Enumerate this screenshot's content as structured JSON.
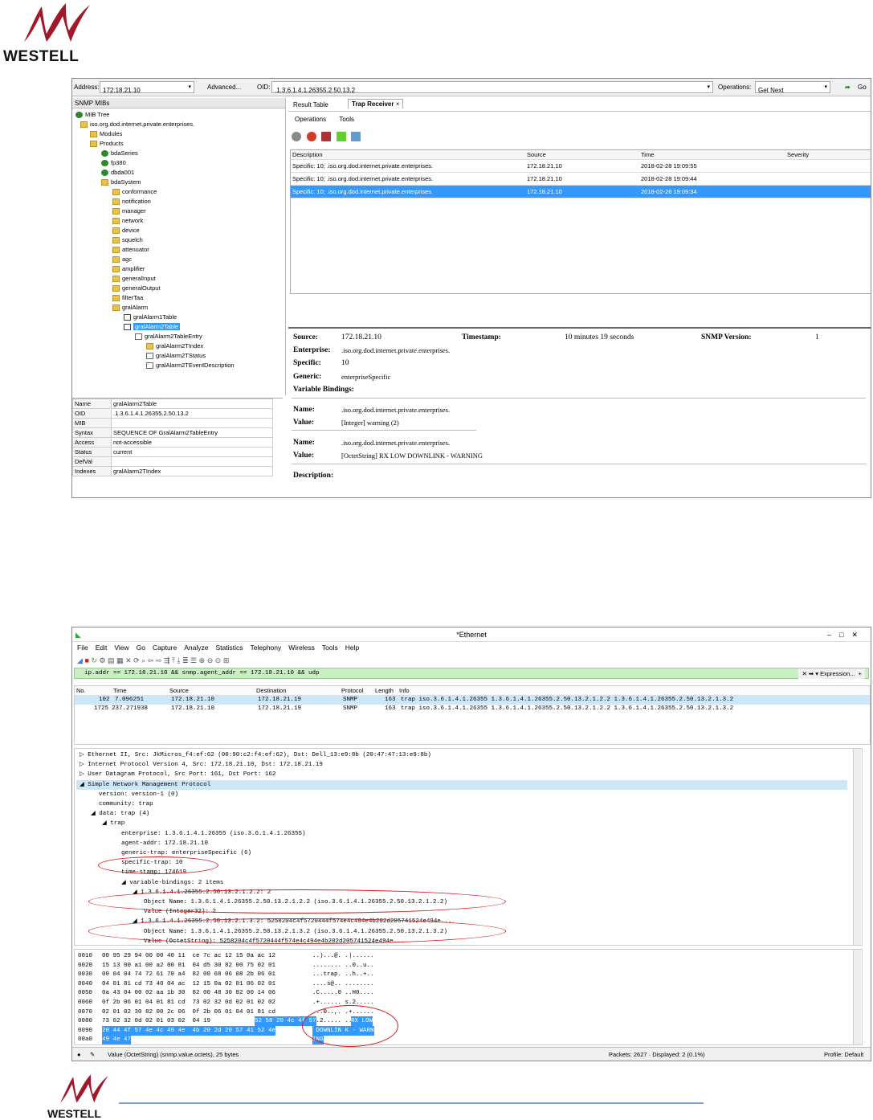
{
  "header_logo": {
    "word": "WESTELL"
  },
  "footer_logo": {
    "word": "WESTELL"
  },
  "mib": {
    "address_label": "Address:",
    "address_value": "172.18.21.10",
    "advanced": "Advanced...",
    "oid_label": "OID:",
    "oid_value": ".1.3.6.1.4.1.26355.2.50.13.2",
    "operations_label": "Operations:",
    "operations_value": "Get Next",
    "go": "Go",
    "left_title": "SNMP MIBs",
    "tree": [
      {
        "label": "MIB Tree",
        "icon": "tree-icon"
      },
      {
        "label": "iso.org.dod.internet.private.enterprises.",
        "icon": "folder-icon"
      },
      {
        "label": "Modules",
        "icon": "folder-icon"
      },
      {
        "label": "Products",
        "icon": "folder-icon"
      },
      {
        "label": "bdaSeries",
        "icon": "leaf-icon"
      },
      {
        "label": "fp380",
        "icon": "leaf-icon"
      },
      {
        "label": "dbda001",
        "icon": "leaf-icon"
      },
      {
        "label": "bdaSystem",
        "icon": "folder-icon"
      },
      {
        "label": "conformance",
        "icon": "folder-icon"
      },
      {
        "label": "notification",
        "icon": "folder-icon"
      },
      {
        "label": "manager",
        "icon": "folder-icon"
      },
      {
        "label": "network",
        "icon": "folder-icon"
      },
      {
        "label": "device",
        "icon": "folder-icon"
      },
      {
        "label": "squelch",
        "icon": "folder-icon"
      },
      {
        "label": "attenuator",
        "icon": "folder-icon"
      },
      {
        "label": "agc",
        "icon": "folder-icon"
      },
      {
        "label": "amplifier",
        "icon": "folder-icon"
      },
      {
        "label": "generalInput",
        "icon": "folder-icon"
      },
      {
        "label": "generalOutput",
        "icon": "folder-icon"
      },
      {
        "label": "filterTaa",
        "icon": "folder-icon"
      },
      {
        "label": "gralAlarm",
        "icon": "folder-icon"
      },
      {
        "label": "gralAlarm1Table",
        "icon": "table-icon"
      },
      {
        "label": "gralAlarm2Table",
        "icon": "table-icon"
      },
      {
        "label": "gralAlarm2TableEntry",
        "icon": "entry-icon"
      },
      {
        "label": "gralAlarm2TIndex",
        "icon": "key-icon"
      },
      {
        "label": "gralAlarm2TStatus",
        "icon": "column-icon"
      },
      {
        "label": "gralAlarm2TEventDescription",
        "icon": "column-icon"
      }
    ],
    "props": [
      [
        "Name",
        "gralAlarm2Table"
      ],
      [
        "OID",
        ".1.3.6.1.4.1.26355.2.50.13.2"
      ],
      [
        "MIB",
        ""
      ],
      [
        "Syntax",
        "SEQUENCE OF GralAlarm2TableEntry"
      ],
      [
        "Access",
        "not-accessible"
      ],
      [
        "Status",
        "current"
      ],
      [
        "DefVal",
        ""
      ],
      [
        "Indexes",
        "gralAlarm2TIndex"
      ]
    ],
    "tab_result": "Result Table",
    "tab_trap": "Trap Receiver",
    "menu_operations": "Operations",
    "menu_tools": "Tools",
    "cols": [
      "Description",
      "Source",
      "Time",
      "Severity"
    ],
    "rows": [
      [
        "Specific: 10; .iso.org.dod.internet.private.enterprises.",
        "172.18.21.10",
        "2018-02-28 19:09:55",
        ""
      ],
      [
        "Specific: 10; .iso.org.dod.internet.private.enterprises.",
        "172.18.21.10",
        "2018-02-28 19:09:44",
        ""
      ],
      [
        "Specific: 10; .iso.org.dod.internet.private.enterprises.",
        "172.18.21.10",
        "2018-02-28 19:09:34",
        ""
      ]
    ],
    "detail": {
      "source_label": "Source:",
      "source": "172.18.21.10",
      "timestamp_label": "Timestamp:",
      "timestamp": "10 minutes 19 seconds",
      "version_label": "SNMP Version:",
      "version": "1",
      "enterprise_label": "Enterprise:",
      "enterprise": ".iso.org.dod.internet.private.enterprises.",
      "specific_label": "Specific:",
      "specific": "10",
      "generic_label": "Generic:",
      "generic": "enterpriseSpecific",
      "vb_label": "Variable Bindings:",
      "name_label": "Name:",
      "value_label": "Value:",
      "name1": ".iso.org.dod.internet.private.enterprises.",
      "value1": "[Integer] warning (2)",
      "name2": ".iso.org.dod.internet.private.enterprises.",
      "value2": "[OctetString] RX LOW DOWNLINK - WARNING",
      "desc_label": "Description:"
    }
  },
  "ws": {
    "title": "*Ethernet",
    "menu": [
      "File",
      "Edit",
      "View",
      "Go",
      "Capture",
      "Analyze",
      "Statistics",
      "Telephony",
      "Wireless",
      "Tools",
      "Help"
    ],
    "filter": "ip.addr == 172.18.21.10 && snmp.agent_addr == 172.18.21.10 && udp",
    "expression": "Expression...",
    "cols": [
      "No.",
      "Time",
      "Source",
      "Destination",
      "Protocol",
      "Length",
      "Info"
    ],
    "packets": [
      [
        "102",
        "7.096251",
        "172.18.21.10",
        "172.18.21.19",
        "SNMP",
        "163",
        "trap iso.3.6.1.4.1.26355 1.3.6.1.4.1.26355.2.50.13.2.1.2.2 1.3.6.1.4.1.26355.2.50.13.2.1.3.2"
      ],
      [
        "1725",
        "237.271938",
        "172.18.21.10",
        "172.18.21.19",
        "SNMP",
        "163",
        "trap iso.3.6.1.4.1.26355 1.3.6.1.4.1.26355.2.50.13.2.1.2.2 1.3.6.1.4.1.26355.2.50.13.2.1.3.2"
      ]
    ],
    "details": [
      "Ethernet II, Src: JkMicros_f4:ef:62 (00:90:c2:f4:ef:62), Dst: Dell_13:e9:8b (20:47:47:13:e9:8b)",
      "Internet Protocol Version 4, Src: 172.18.21.10, Dst: 172.18.21.19",
      "User Datagram Protocol, Src Port: 161, Dst Port: 162",
      "Simple Network Management Protocol",
      "version: version-1 (0)",
      "community: trap",
      "data: trap (4)",
      "trap",
      "enterprise: 1.3.6.1.4.1.26355 (iso.3.6.1.4.1.26355)",
      "agent-addr: 172.18.21.10",
      "generic-trap: enterpriseSpecific (6)",
      "specific-trap: 10",
      "time-stamp: 174619",
      "variable-bindings: 2 items",
      "1.3.6.1.4.1.26355.2.50.13.2.1.2.2: 2",
      "Object Name: 1.3.6.1.4.1.26355.2.50.13.2.1.2.2 (iso.3.6.1.4.1.26355.2.50.13.2.1.2.2)",
      "Value (Integer32): 2",
      "1.3.6.1.4.1.26355.2.50.13.2.1.3.2: 5258204c4f5720444f574e4c494e4b202d205741524e494e...",
      "Object Name: 1.3.6.1.4.1.26355.2.50.13.2.1.3.2 (iso.3.6.1.4.1.26355.2.50.13.2.1.3.2)",
      "Value (OctetString): 5258204c4f5720444f574e4c494e4b202d205741524e494e..."
    ],
    "hex": [
      [
        "0010",
        "00 95 29 94 00 00 40 11  ce 7c ac 12 15 0a ac 12",
        "..)...@. .|......",
        ""
      ],
      [
        "0020",
        "15 13 00 a1 00 a2 00 81  04 d5 30 82 00 75 02 01",
        "........ ..0..u..",
        ""
      ],
      [
        "0030",
        "00 04 04 74 72 61 70 a4  82 00 68 06 08 2b 06 01",
        "...trap. ..h..+..",
        ""
      ],
      [
        "0040",
        "04 01 81 cd 73 40 04 ac  12 15 0a 02 01 06 02 01",
        "....s@.. ........",
        ""
      ],
      [
        "0050",
        "0a 43 04 00 02 aa 1b 30  82 00 48 30 82 00 14 06",
        ".C.....0 ..H0....",
        ""
      ],
      [
        "0060",
        "0f 2b 06 01 04 01 81 cd  73 02 32 0d 02 01 02 02",
        ".+...... s.2.....",
        ""
      ],
      [
        "0070",
        "02 01 02 30 82 00 2c 06  0f 2b 06 01 04 01 81 cd",
        "...0..,. .+......",
        ""
      ],
      [
        "0080",
        "73 02 32 0d 02 01 03 02  04 19 ",
        "s.2..... ..",
        "52 58 20 4c 4f 57|RX LOW"
      ],
      [
        "0090",
        "",
        "",
        "20 44 4f 57 4e 4c 49 4e  4b 20 2d 20 57 41 52 4e| DOWNLIN K - WARN"
      ],
      [
        "00a0",
        "",
        "",
        "49 4e 47|ING"
      ]
    ],
    "status_left": "Value (OctetString) (snmp.value.octets), 25 bytes",
    "status_mid": "Packets: 2627 · Displayed: 2 (0.1%)",
    "status_right": "Profile: Default"
  }
}
